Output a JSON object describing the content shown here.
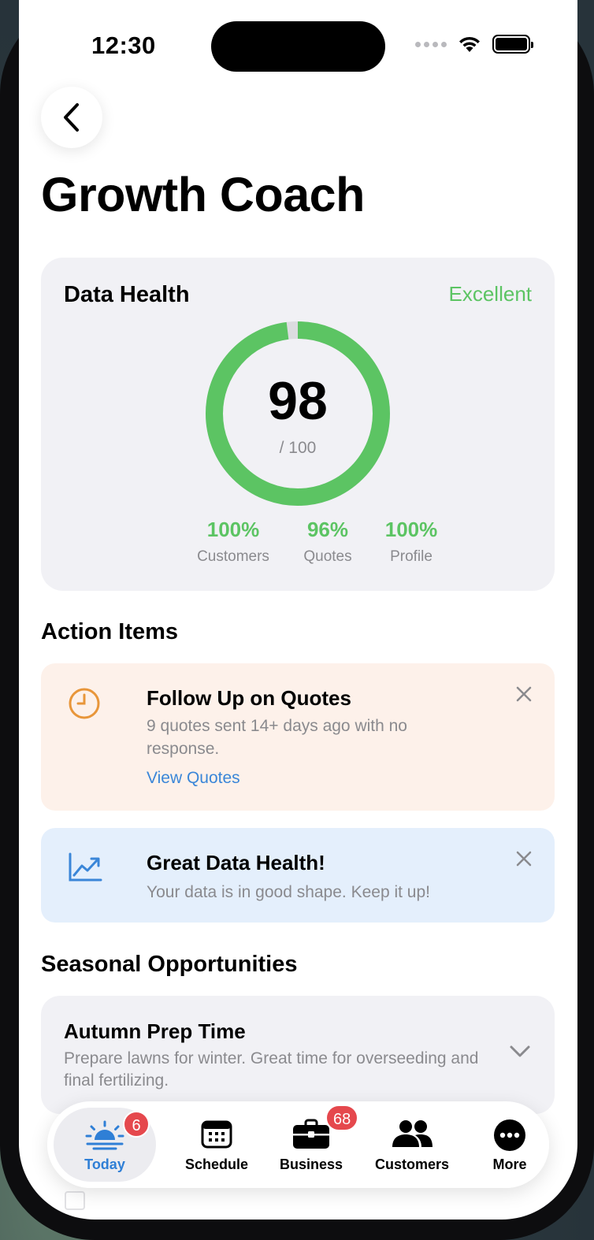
{
  "status_bar": {
    "time": "12:30"
  },
  "header": {
    "title": "Growth Coach"
  },
  "data_health": {
    "title": "Data Health",
    "status": "Excellent",
    "score": "98",
    "score_max": "/ 100",
    "score_fraction": 0.98,
    "metrics": [
      {
        "value": "100%",
        "label": "Customers"
      },
      {
        "value": "96%",
        "label": "Quotes"
      },
      {
        "value": "100%",
        "label": "Profile"
      }
    ],
    "accent_color": "#5cc463"
  },
  "action_items": {
    "title": "Action Items",
    "items": [
      {
        "icon": "clock-icon",
        "title": "Follow Up on Quotes",
        "description": "9 quotes sent 14+ days ago with no response.",
        "link": "View Quotes"
      },
      {
        "icon": "trending-up-icon",
        "title": "Great Data Health!",
        "description": "Your data is in good shape. Keep it up!"
      }
    ]
  },
  "seasonal": {
    "title": "Seasonal Opportunities",
    "items": [
      {
        "title": "Autumn Prep Time",
        "description": "Prepare lawns for winter. Great time for overseeding and final fertilizing."
      }
    ]
  },
  "tabbar": {
    "tabs": [
      {
        "label": "Today",
        "icon": "sunrise-icon",
        "badge": "6",
        "active": true
      },
      {
        "label": "Schedule",
        "icon": "calendar-icon"
      },
      {
        "label": "Business",
        "icon": "briefcase-icon",
        "badge": "68"
      },
      {
        "label": "Customers",
        "icon": "people-icon"
      },
      {
        "label": "More",
        "icon": "more-icon"
      }
    ],
    "active_color": "#2f7fd6",
    "badge_color": "#e5484d"
  }
}
